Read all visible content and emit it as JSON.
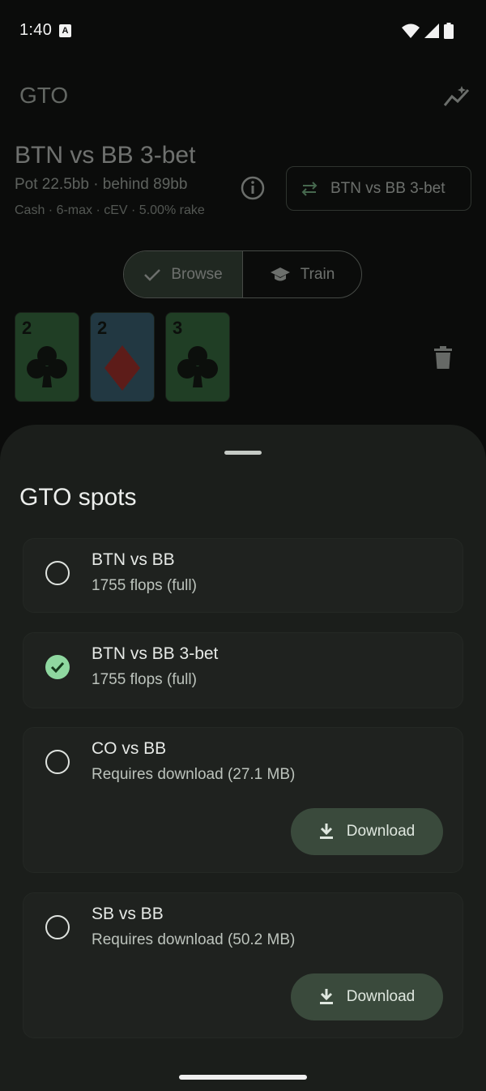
{
  "status_bar": {
    "time": "1:40",
    "notification_letter": "A"
  },
  "app": {
    "title": "GTO",
    "spot_title": "BTN vs BB 3-bet",
    "pot_line": "Pot 22.5bb · behind 89bb",
    "meta_line": "Cash · 6-max · cEV · 5.00% rake",
    "switch_label": "BTN vs BB 3-bet",
    "modes": [
      {
        "label": "Browse",
        "icon": "check-icon",
        "selected": true
      },
      {
        "label": "Train",
        "icon": "school-cap-icon",
        "selected": false
      }
    ],
    "board": [
      {
        "rank": "2",
        "suit": "clubs",
        "color": "#3b7c45"
      },
      {
        "rank": "2",
        "suit": "diamonds",
        "color": "#3f6f86"
      },
      {
        "rank": "3",
        "suit": "clubs",
        "color": "#3b7c45"
      }
    ]
  },
  "sheet": {
    "title": "GTO spots",
    "spots": [
      {
        "name": "BTN vs BB",
        "sub": "1755 flops (full)",
        "selected": false,
        "download": null
      },
      {
        "name": "BTN vs BB 3-bet",
        "sub": "1755 flops (full)",
        "selected": true,
        "download": null
      },
      {
        "name": "CO vs BB",
        "sub": "Requires download (27.1 MB)",
        "selected": false,
        "download": "Download"
      },
      {
        "name": "SB vs BB",
        "sub": "Requires download (50.2 MB)",
        "selected": false,
        "download": "Download"
      }
    ]
  },
  "colors": {
    "accent": "#8fd8a0",
    "sheet_bg": "#1b1e1b",
    "download_bg": "#3a4a3c",
    "diamond_red": "#c0312b"
  }
}
